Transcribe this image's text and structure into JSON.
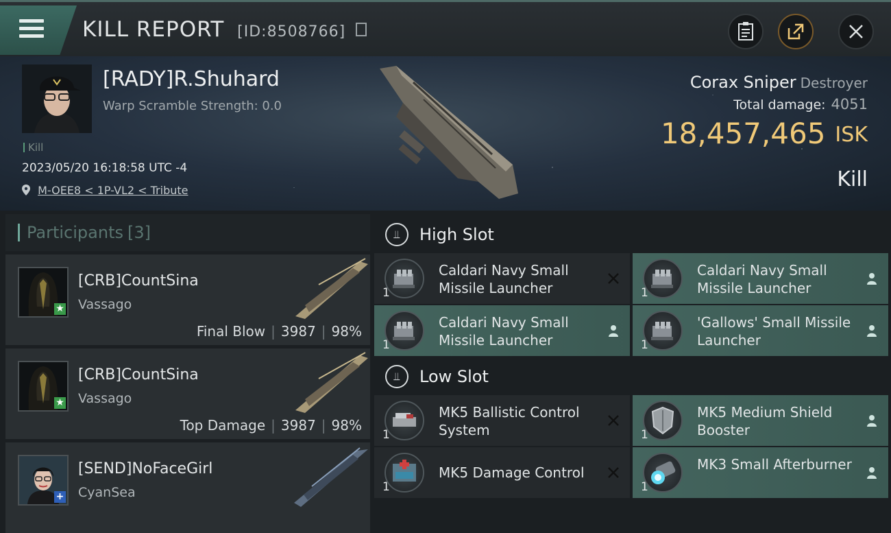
{
  "header": {
    "title": "KILL REPORT",
    "report_id": "[ID:8508766]"
  },
  "victim": {
    "name": "[RADY]R.Shuhard",
    "warp_scramble": "Warp Scramble Strength: 0.0",
    "kill_tag": "Kill",
    "datetime": "2023/05/20 16:18:58 UTC -4",
    "location": "M-OEE8 < 1P-VL2 < Tribute",
    "ship_name": "Corax Sniper",
    "ship_class": "Destroyer",
    "total_damage_label": "Total damage:",
    "total_damage": "4051",
    "isk_value": "18,457,465",
    "isk_unit": "ISK",
    "result": "Kill"
  },
  "participants": {
    "label": "Participants",
    "count": "[3]",
    "list": [
      {
        "name": "[CRB]CountSina",
        "ship": "Vassago",
        "role": "Final Blow",
        "damage": "3987",
        "percent": "98%",
        "badge": "★",
        "badge_color": "#3a9a4a"
      },
      {
        "name": "[CRB]CountSina",
        "ship": "Vassago",
        "role": "Top Damage",
        "damage": "3987",
        "percent": "98%",
        "badge": "★",
        "badge_color": "#3a9a4a"
      },
      {
        "name": "[SEND]NoFaceGirl",
        "ship": "CyanSea",
        "role": "",
        "damage": "",
        "percent": "",
        "badge": "+",
        "badge_color": "#2e5fb8"
      }
    ]
  },
  "slots": {
    "high": {
      "title": "High Slot",
      "modules": [
        {
          "name": "Caldari Navy Small Missile Launcher",
          "qty": "1",
          "status": "destroyed",
          "icon": "missile-launcher-icon"
        },
        {
          "name": "Caldari Navy Small Missile Launcher",
          "qty": "1",
          "status": "dropped",
          "icon": "missile-launcher-icon"
        },
        {
          "name": "Caldari Navy Small Missile Launcher",
          "qty": "1",
          "status": "dropped",
          "icon": "missile-launcher-icon"
        },
        {
          "name": "'Gallows' Small Missile Launcher",
          "qty": "1",
          "status": "dropped",
          "icon": "missile-launcher-icon"
        }
      ]
    },
    "low": {
      "title": "Low Slot",
      "modules": [
        {
          "name": "MK5 Ballistic Control System",
          "qty": "1",
          "status": "destroyed",
          "icon": "ballistic-control-icon"
        },
        {
          "name": "MK5 Medium Shield Booster",
          "qty": "1",
          "status": "dropped",
          "icon": "shield-booster-icon"
        },
        {
          "name": "MK5 Damage Control",
          "qty": "1",
          "status": "destroyed",
          "icon": "damage-control-icon"
        },
        {
          "name": "MK3 Small Afterburner",
          "qty": "1",
          "status": "dropped",
          "icon": "afterburner-icon"
        }
      ]
    }
  },
  "colors": {
    "accent": "#4e6a66",
    "isk": "#f0c978",
    "dropped_highlight": "#44655e"
  }
}
